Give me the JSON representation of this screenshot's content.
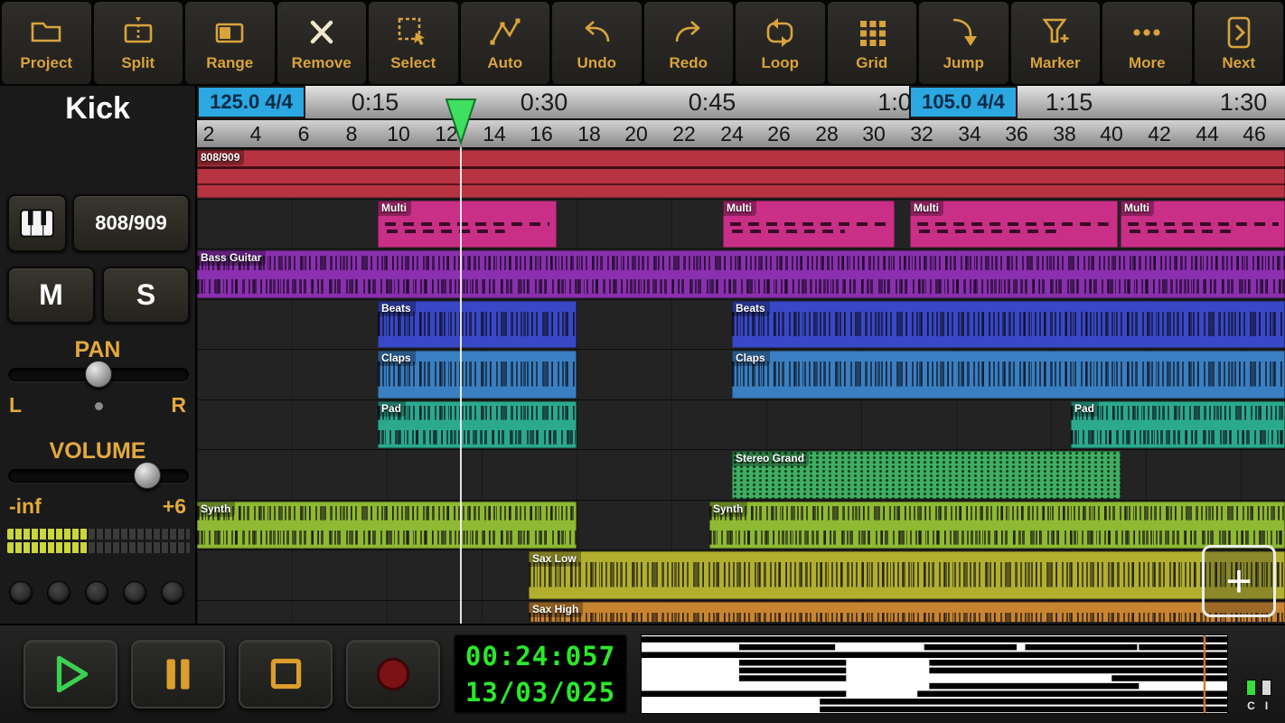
{
  "toolbar": {
    "items": [
      {
        "label": "Project",
        "icon": "folder-icon"
      },
      {
        "label": "Split",
        "icon": "split-icon"
      },
      {
        "label": "Range",
        "icon": "range-icon"
      },
      {
        "label": "Remove",
        "icon": "remove-icon"
      },
      {
        "label": "Select",
        "icon": "select-icon"
      },
      {
        "label": "Auto",
        "icon": "automation-icon"
      },
      {
        "label": "Undo",
        "icon": "undo-icon"
      },
      {
        "label": "Redo",
        "icon": "redo-icon"
      },
      {
        "label": "Loop",
        "icon": "loop-icon"
      },
      {
        "label": "Grid",
        "icon": "grid-icon"
      },
      {
        "label": "Jump",
        "icon": "jump-icon"
      },
      {
        "label": "Marker",
        "icon": "marker-icon"
      },
      {
        "label": "More",
        "icon": "more-icon"
      },
      {
        "label": "Next",
        "icon": "next-icon"
      }
    ]
  },
  "sidebar": {
    "track_name": "Kick",
    "instrument_label": "808/909",
    "mute_label": "M",
    "solo_label": "S",
    "pan": {
      "label": "PAN",
      "left": "L",
      "right": "R"
    },
    "volume": {
      "label": "VOLUME",
      "min": "-inf",
      "max": "+6"
    }
  },
  "ruler": {
    "tempo_markers": [
      {
        "label": "125.0 4/4"
      },
      {
        "label": "105.0 4/4"
      }
    ],
    "time_labels": [
      "0:15",
      "0:30",
      "0:45",
      "1:0",
      "1:15",
      "1:30"
    ],
    "bar_numbers": [
      "2",
      "4",
      "6",
      "8",
      "10",
      "12",
      "14",
      "16",
      "18",
      "20",
      "22",
      "24",
      "26",
      "28",
      "30",
      "32",
      "34",
      "36",
      "38",
      "40",
      "42",
      "44",
      "46"
    ]
  },
  "tracks": [
    {
      "name": "808/909",
      "color": "#b73341"
    },
    {
      "name": "Multi",
      "color": "#c92f86"
    },
    {
      "name": "Bass Guitar",
      "color": "#8a2fae"
    },
    {
      "name": "Beats",
      "color": "#3948c6"
    },
    {
      "name": "Claps",
      "color": "#3a7fc2"
    },
    {
      "name": "Pad",
      "color": "#2aa98d"
    },
    {
      "name": "Stereo Grand",
      "color": "#3fae62"
    },
    {
      "name": "Synth",
      "color": "#8eb932"
    },
    {
      "name": "Sax Low",
      "color": "#b2af2f"
    },
    {
      "name": "Sax High",
      "color": "#c8842f"
    }
  ],
  "timeline": {
    "add_track_label": "+"
  },
  "transport": {
    "time_display": "00:24:057",
    "date_display": "13/03/025",
    "meter_labels": {
      "c": "C",
      "i": "I"
    }
  },
  "colors": {
    "accent_gold": "#d9a33c",
    "tempo_blue": "#2ba7e2",
    "playhead_green": "#3fe060",
    "led_green": "#2be82b"
  }
}
